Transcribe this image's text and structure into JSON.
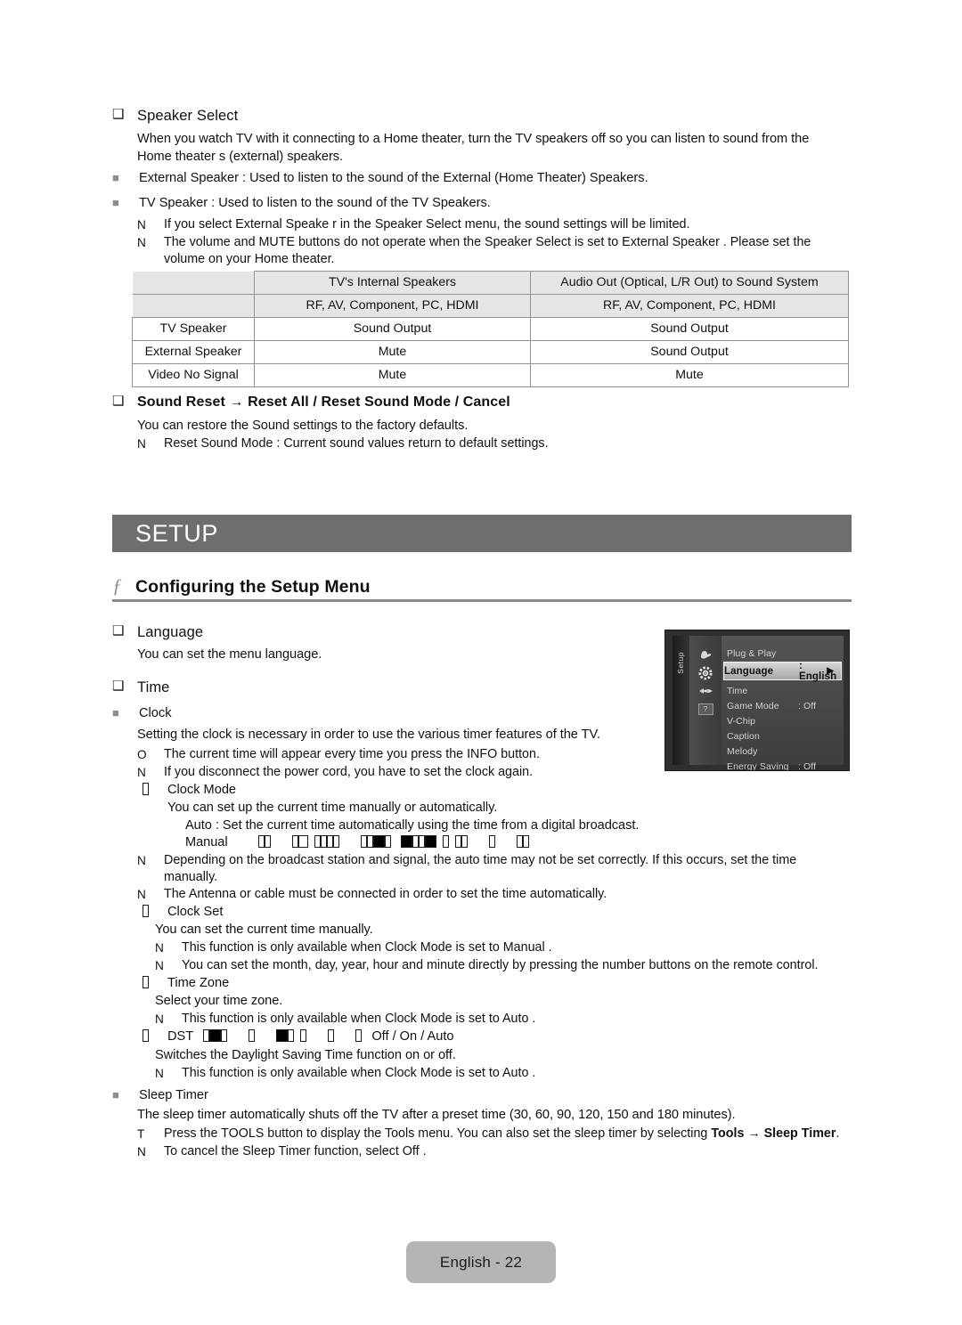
{
  "speaker_select": {
    "heading": "Speaker Select",
    "paragraph": "When you watch TV with it connecting to a Home theater, turn the TV speakers off so you can listen to sound from the Home theater s (external) speakers.",
    "bullets": [
      "External Speaker  : Used to listen to the sound of the External (Home Theater) Speakers.",
      "TV Speaker : Used to listen to the sound of the TV Speakers."
    ],
    "notes": [
      {
        "marker": "N",
        "text": "If you select External Speake r in the Speaker Select  menu, the sound settings will be limited."
      },
      {
        "marker": "N",
        "text": "The volume and MUTE buttons do not operate when the Speaker Select  is set to External Speaker . Please set the volume on your Home theater."
      }
    ]
  },
  "speaker_table": {
    "col_headers": [
      "",
      "TV's Internal Speakers",
      "Audio Out (Optical, L/R Out) to Sound System"
    ],
    "sub_headers": [
      "",
      "RF, AV, Component, PC, HDMI",
      "RF, AV, Component, PC, HDMI"
    ],
    "rows": [
      {
        "label": "TV Speaker",
        "cells": [
          "Sound Output",
          "Sound Output"
        ]
      },
      {
        "label": "External Speaker",
        "cells": [
          "Mute",
          "Sound Output"
        ]
      },
      {
        "label": "Video No Signal",
        "cells": [
          "Mute",
          "Mute"
        ]
      }
    ]
  },
  "sound_reset": {
    "heading": "Sound Reset → Reset All / Reset Sound Mode / Cancel",
    "paragraph": "You can restore the Sound settings to the factory defaults.",
    "notes": [
      {
        "marker": "N",
        "text": "Reset Sound Mode  : Current sound values return to default settings."
      }
    ]
  },
  "setup_banner": {
    "title": "SETUP"
  },
  "setup_section": {
    "fglyph": "ƒ",
    "title": "Configuring the Setup Menu"
  },
  "language": {
    "heading": "Language",
    "paragraph": "You can set the menu language."
  },
  "time": {
    "heading": "Time",
    "clock": {
      "label": "Clock",
      "paragraph": "Setting the clock is necessary in order to use the various timer features of the TV.",
      "notes": [
        {
          "marker": "O",
          "text": "The current time will appear every time you press the INFO button."
        },
        {
          "marker": "N",
          "text": "If you disconnect the power cord, you have to set the clock again."
        }
      ]
    },
    "clock_mode": {
      "label": "Clock Mode",
      "paragraph": "You can set up the current time manually or automatically.",
      "auto": "Auto : Set the current time automatically using the time from a digital broadcast.",
      "manual_label": "Manual",
      "notes": [
        {
          "marker": "N",
          "text": "Depending on the broadcast station and signal, the auto time may not be set correctly. If this occurs, set the time manually."
        },
        {
          "marker": "N",
          "text": "The Antenna or cable must be connected in order to set the time automatically."
        }
      ]
    },
    "clock_set": {
      "label": "Clock Set",
      "paragraph": "You can set the current time manually.",
      "notes": [
        {
          "marker": "N",
          "text": "This function is only available when Clock Mode  is set to Manual ."
        },
        {
          "marker": "N",
          "text": "You can set the month, day, year, hour and minute directly by pressing the number buttons on the remote control."
        }
      ]
    },
    "time_zone": {
      "label": "Time Zone",
      "paragraph": "Select your time zone.",
      "notes": [
        {
          "marker": "N",
          "text": "This function is only available when Clock Mode  is set to Auto ."
        }
      ]
    },
    "dst": {
      "label": "DST",
      "options": "Off / On / Auto",
      "paragraph": "Switches the Daylight Saving Time function on or off.",
      "notes": [
        {
          "marker": "N",
          "text": "This function is only available when Clock Mode  is set to Auto ."
        }
      ]
    },
    "sleep_timer": {
      "label": "Sleep Timer",
      "paragraph": "The sleep timer automatically shuts off the TV after a preset time (30, 60, 90, 120, 150 and 180 minutes).",
      "note_tools_pre": "Press the TOOLS button to display the Tools  menu. You can also set the sleep timer by selecting ",
      "note_tools_bold": "Tools → Sleep Timer",
      "note_tools_post": ".",
      "notes": [
        {
          "marker": "N",
          "text": "To cancel the Sleep Timer  function, select Off ."
        }
      ]
    }
  },
  "osd": {
    "rail_label": "Setup",
    "items": [
      {
        "label": "Plug & Play",
        "value": "",
        "highlighted": false
      },
      {
        "label": "Language",
        "value": ": English",
        "highlighted": true,
        "arrow": "▶"
      },
      {
        "label": "Time",
        "value": "",
        "highlighted": false
      },
      {
        "label": "Game Mode",
        "value": ": Off",
        "highlighted": false
      },
      {
        "label": "V-Chip",
        "value": "",
        "highlighted": false
      },
      {
        "label": "Caption",
        "value": "",
        "highlighted": false
      },
      {
        "label": "Melody",
        "value": "",
        "highlighted": false
      },
      {
        "label": "Energy Saving",
        "value": ": Off",
        "highlighted": false
      }
    ],
    "icons": [
      "hand-icon",
      "gear-icon",
      "plug-icon",
      "question-icon"
    ]
  },
  "footer": {
    "page_label": "English - 22"
  },
  "colors": {
    "banner_bg": "#6e6e6e",
    "table_header_bg": "#e6e6e6",
    "footer_bg": "#b5b5b5",
    "rule": "#8a8a8a"
  }
}
